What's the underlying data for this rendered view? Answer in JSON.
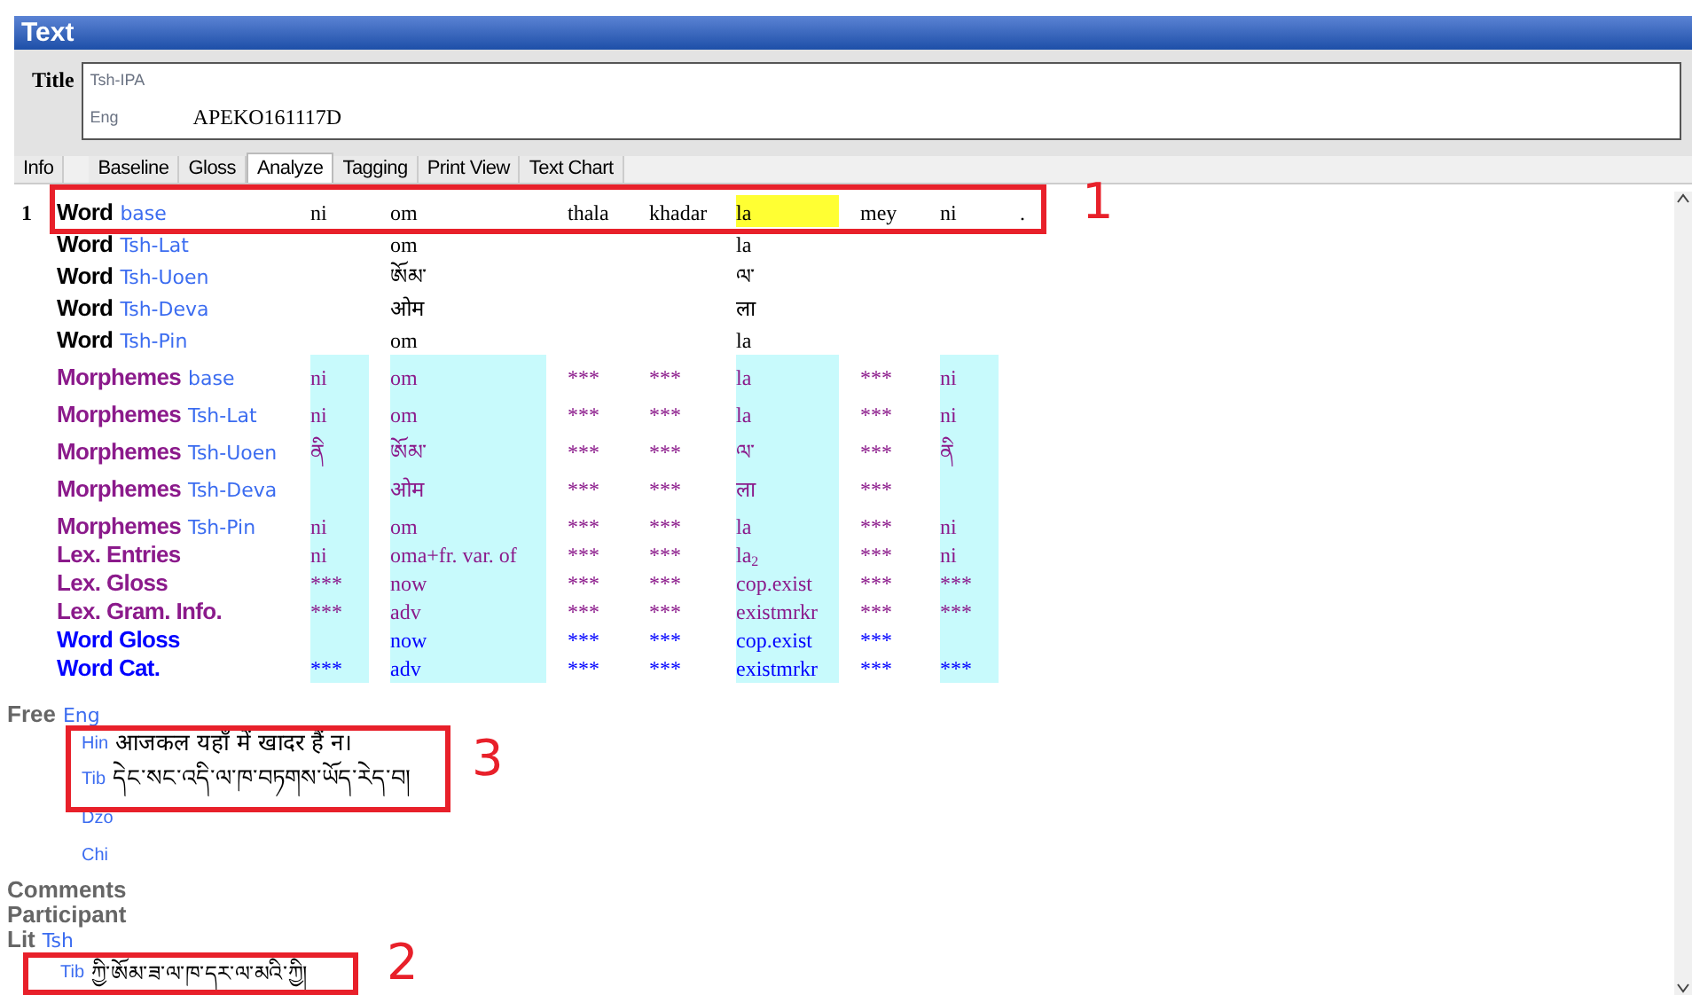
{
  "window": {
    "title": "Text"
  },
  "title_field": {
    "label": "Title",
    "lines": [
      {
        "ws": "Tsh-IPA"
      },
      {
        "ws": "Eng",
        "value": "APEKO161117D"
      }
    ]
  },
  "tabs": [
    {
      "label": "Info",
      "selected": false
    },
    {
      "label": "Baseline",
      "selected": false
    },
    {
      "label": "Gloss",
      "selected": false
    },
    {
      "label": "Analyze",
      "selected": true
    },
    {
      "label": "Tagging",
      "selected": false
    },
    {
      "label": "Print View",
      "selected": false
    },
    {
      "label": "Text Chart",
      "selected": false
    }
  ],
  "segment": {
    "number": "1",
    "columns": [
      {
        "analyzed": true,
        "selected": false
      },
      {
        "analyzed": true,
        "selected": false
      },
      {
        "analyzed": false,
        "selected": false
      },
      {
        "analyzed": false,
        "selected": false
      },
      {
        "analyzed": true,
        "selected": true
      },
      {
        "analyzed": false,
        "selected": false
      },
      {
        "analyzed": true,
        "selected": false
      },
      {
        "analyzed": false,
        "selected": false
      }
    ],
    "lines": [
      {
        "kind": "word",
        "label": "Word",
        "ws": "base",
        "cells": [
          "ni",
          "om",
          "thala",
          "khadar",
          "la",
          "mey",
          "ni",
          "."
        ]
      },
      {
        "kind": "word",
        "label": "Word",
        "ws": "Tsh-Lat",
        "cells": [
          "",
          "om",
          "",
          "",
          "la",
          "",
          "",
          ""
        ]
      },
      {
        "kind": "word",
        "label": "Word",
        "ws": "Tsh-Uoen",
        "cells": [
          "",
          "ཨོམ་",
          "",
          "",
          "ལ་",
          "",
          "",
          ""
        ]
      },
      {
        "kind": "word",
        "label": "Word",
        "ws": "Tsh-Deva",
        "cells": [
          "",
          "ओम",
          "",
          "",
          "ला",
          "",
          "",
          ""
        ]
      },
      {
        "kind": "word",
        "label": "Word",
        "ws": "Tsh-Pin",
        "cells": [
          "",
          "om",
          "",
          "",
          "la",
          "",
          "",
          ""
        ]
      },
      {
        "kind": "morpheme",
        "label": "Morphemes",
        "ws": "base",
        "cells": [
          "ni",
          "om",
          "***",
          "***",
          "la",
          "***",
          "ni",
          ""
        ]
      },
      {
        "kind": "morpheme",
        "label": "Morphemes",
        "ws": "Tsh-Lat",
        "cells": [
          "ni",
          "om",
          "***",
          "***",
          "la",
          "***",
          "ni",
          ""
        ]
      },
      {
        "kind": "morpheme",
        "label": "Morphemes",
        "ws": "Tsh-Uoen",
        "cells": [
          "ནི",
          "ཨོམ་",
          "***",
          "***",
          "ལ་",
          "***",
          "ནི",
          ""
        ]
      },
      {
        "kind": "morpheme",
        "label": "Morphemes",
        "ws": "Tsh-Deva",
        "cells": [
          "",
          "ओम",
          "***",
          "***",
          "ला",
          "***",
          "",
          ""
        ]
      },
      {
        "kind": "morpheme",
        "label": "Morphemes",
        "ws": "Tsh-Pin",
        "cells": [
          "ni",
          "om",
          "***",
          "***",
          "la",
          "***",
          "ni",
          ""
        ]
      },
      {
        "kind": "lex",
        "label": "Lex. Entries",
        "cells": [
          "ni",
          "oma+fr. var. of",
          "***",
          "***",
          "la$_{2}$",
          "***",
          "ni",
          ""
        ]
      },
      {
        "kind": "lex",
        "label": "Lex. Gloss",
        "cells": [
          "***",
          "now",
          "***",
          "***",
          "cop.exist",
          "***",
          "***",
          ""
        ]
      },
      {
        "kind": "lex",
        "label": "Lex. Gram. Info.",
        "cells": [
          "***",
          "adv",
          "***",
          "***",
          "existmrkr",
          "***",
          "***",
          ""
        ]
      },
      {
        "kind": "gloss",
        "label": "Word Gloss",
        "cells": [
          "",
          "now",
          "***",
          "***",
          "cop.exist",
          "***",
          "",
          ""
        ]
      },
      {
        "kind": "gloss",
        "label": "Word Cat.",
        "cells": [
          "***",
          "adv",
          "***",
          "***",
          "existmrkr",
          "***",
          "***",
          ""
        ]
      }
    ]
  },
  "free": {
    "label": "Free",
    "ws": "Eng",
    "translations": [
      {
        "ws": "Hin",
        "text": "आजकल यहाँ में खादर हैं न।"
      },
      {
        "ws": "Tib",
        "text": "དེང་སང་འདི་ལ་ཁ་བཏགས་ཡོད་རེད་བ།"
      },
      {
        "ws": "Dzo"
      },
      {
        "ws": "Chi"
      }
    ]
  },
  "comments": {
    "label": "Comments"
  },
  "participant": {
    "label": "Participant"
  },
  "literal": {
    "label": "Lit",
    "ws": "Tsh",
    "translations": [
      {
        "ws": "Tib",
        "text": "ཀྱི་ཨོམ་ཟ་ལ་ཁ་དར་ལ་མའི་ཀྱི།"
      }
    ]
  },
  "annotations": [
    {
      "label": "1"
    },
    {
      "label": "3"
    },
    {
      "label": "2"
    }
  ]
}
